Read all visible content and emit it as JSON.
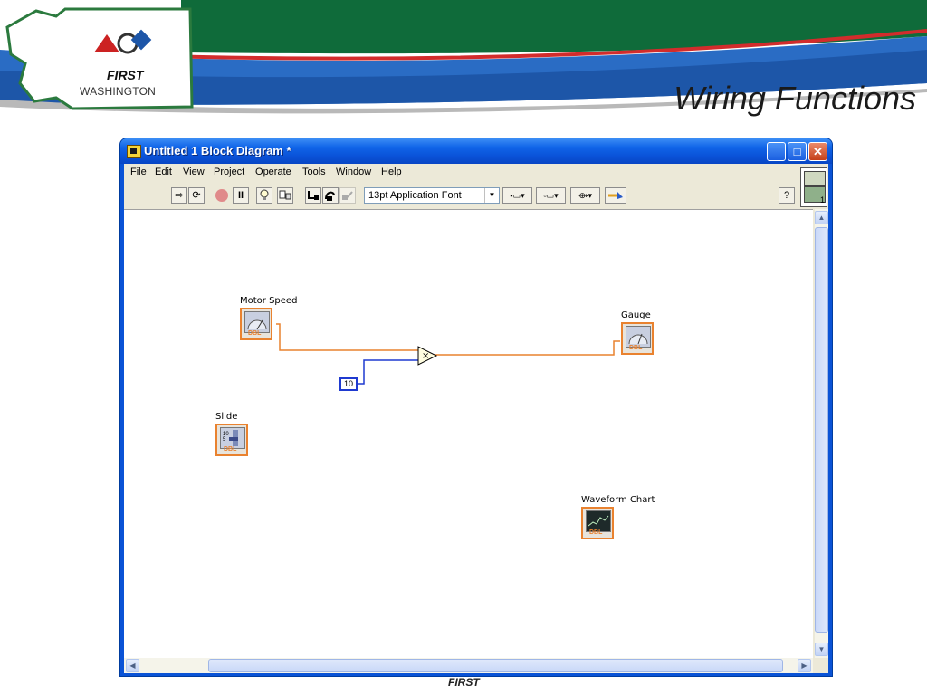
{
  "slide": {
    "title": "Wiring Functions",
    "logo_first": "FIRST",
    "logo_region": "WASHINGTON",
    "footer": "FIRST"
  },
  "window": {
    "title": "Untitled 1 Block Diagram *",
    "minimize_glyph": "_",
    "maximize_glyph": "□",
    "close_glyph": "✕"
  },
  "menu": [
    "File",
    "Edit",
    "View",
    "Project",
    "Operate",
    "Tools",
    "Window",
    "Help"
  ],
  "toolbar": {
    "font": "13pt Application Font",
    "run_glyph": "⇨",
    "run_continuous_glyph": "⟳",
    "pause_glyph": "II",
    "highlight_glyph": "💡",
    "help_glyph": "?"
  },
  "diagram": {
    "motor_speed_label": "Motor Speed",
    "gauge_label": "Gauge",
    "slide_label": "Slide",
    "waveform_label": "Waveform Chart",
    "constant_value": "10",
    "multiply_glyph": "×",
    "dbl": "DBL"
  },
  "icons": {
    "run": "run-arrow-icon",
    "abort": "abort-icon",
    "pause": "pause-icon",
    "highlight": "lightbulb-icon"
  },
  "colors": {
    "titlebar": "#0a52d8",
    "numeric_wire": "#e9822f",
    "integer_wire": "#1f3ad0",
    "header_green": "#0f6b3a",
    "header_blue": "#1d5fb8",
    "header_red": "#d22c2c"
  }
}
